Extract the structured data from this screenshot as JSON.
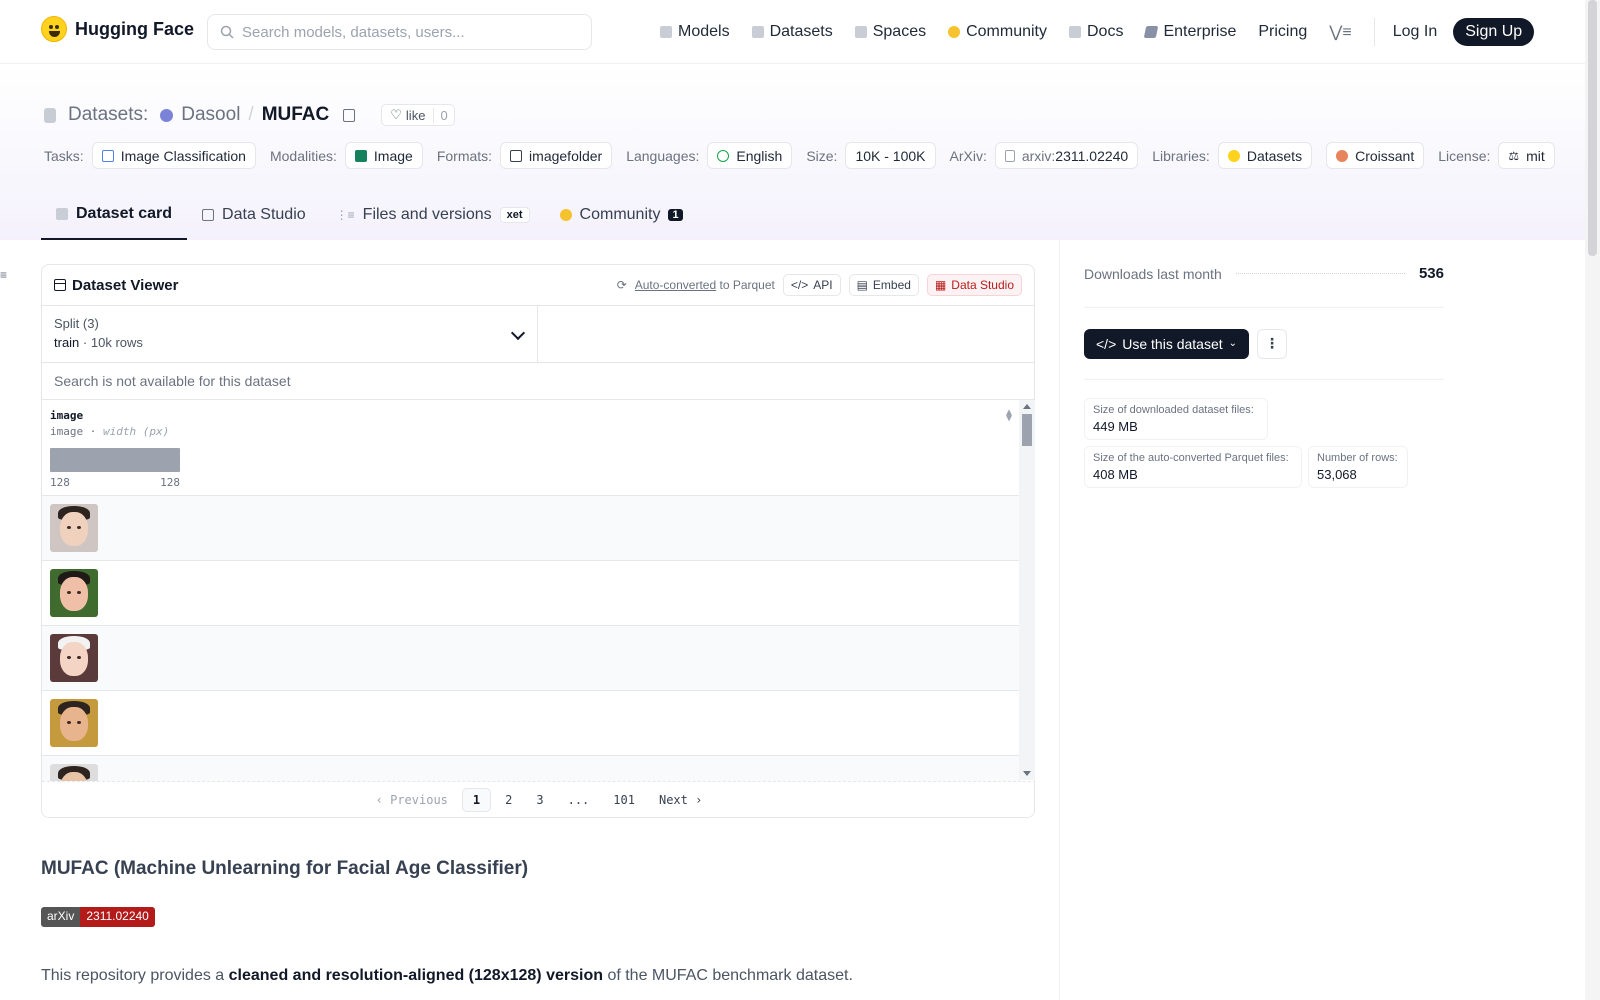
{
  "nav": {
    "logo_text": "Hugging Face",
    "search_placeholder": "Search models, datasets, users...",
    "links": [
      "Models",
      "Datasets",
      "Spaces",
      "Community",
      "Docs",
      "Enterprise",
      "Pricing"
    ],
    "login": "Log In",
    "signup": "Sign Up"
  },
  "repo": {
    "type_label": "Datasets:",
    "owner": "Dasool",
    "separator": "/",
    "name": "MUFAC",
    "like_label": "like",
    "like_count": "0"
  },
  "tags": {
    "tasks_label": "Tasks:",
    "tasks_value": "Image Classification",
    "modalities_label": "Modalities:",
    "modalities_value": "Image",
    "formats_label": "Formats:",
    "formats_value": "imagefolder",
    "languages_label": "Languages:",
    "languages_value": "English",
    "size_label": "Size:",
    "size_value": "10K - 100K",
    "arxiv_label": "ArXiv:",
    "arxiv_prefix": "arxiv:",
    "arxiv_value": "2311.02240",
    "libraries_label": "Libraries:",
    "lib1": "Datasets",
    "lib2": "Croissant",
    "license_label": "License:",
    "license_value": "mit"
  },
  "tabs": {
    "dataset_card": "Dataset card",
    "data_studio": "Data Studio",
    "files": "Files and versions",
    "xet": "xet",
    "community": "Community",
    "community_count": "1"
  },
  "viewer": {
    "title": "Dataset Viewer",
    "auto_converted": "Auto-converted",
    "to_parquet": "to Parquet",
    "api": "API",
    "embed": "Embed",
    "data_studio": "Data Studio",
    "split_label": "Split (3)",
    "split_value": "train",
    "split_dot": "·",
    "split_rows": "10k rows",
    "search_disabled": "Search is not available for this dataset",
    "column_name": "image",
    "column_type": "image",
    "column_type_sep": "·",
    "column_stat": "width (px)",
    "hist_min": "128",
    "hist_max": "128",
    "pager": {
      "previous": "Previous",
      "pages": [
        "1",
        "2",
        "3",
        "...",
        "101"
      ],
      "next": "Next"
    }
  },
  "readme": {
    "title": "MUFAC (Machine Unlearning for Facial Age Classifier)",
    "badge_left": "arXiv",
    "badge_right": "2311.02240",
    "para_start": "This repository provides a",
    "para_bold": "cleaned and resolution-aligned (128x128) version",
    "para_end": "of the MUFAC benchmark dataset."
  },
  "sidebar": {
    "downloads_label": "Downloads last month",
    "downloads_count": "536",
    "use_dataset": "Use this dataset",
    "stats": [
      {
        "label": "Size of downloaded dataset files:",
        "value": "449 MB"
      },
      {
        "label": "Size of the auto-converted Parquet files:",
        "value": "408 MB"
      },
      {
        "label": "Number of rows:",
        "value": "53,068"
      }
    ]
  },
  "colors": {
    "accent_dark": "#111827",
    "brand_yellow": "#ffd21e",
    "arxiv_red": "#b31b1b"
  }
}
